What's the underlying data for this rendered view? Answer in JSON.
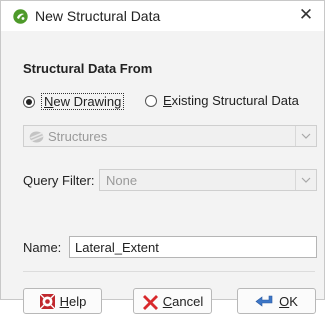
{
  "window": {
    "title": "New Structural Data",
    "close_glyph": "✕",
    "icon": "leapfrog-app-icon"
  },
  "section": {
    "heading": "Structural Data From"
  },
  "source_options": [
    {
      "label_mnemonic": "N",
      "label_rest": "ew Drawing",
      "selected": true
    },
    {
      "label_mnemonic": "E",
      "label_rest": "xisting Structural Data",
      "selected": false
    }
  ],
  "structures_select": {
    "value": "Structures",
    "disabled": true,
    "icon": "structures-icon"
  },
  "query_filter": {
    "label": "Query Filter:",
    "value": "None",
    "disabled": true
  },
  "name_field": {
    "label": "Name:",
    "value": "Lateral_Extent"
  },
  "buttons": {
    "help": {
      "mnemonic": "H",
      "rest": "elp",
      "icon": "help-lifebuoy-icon"
    },
    "cancel": {
      "mnemonic": "C",
      "rest": "ancel",
      "icon": "cancel-x-icon"
    },
    "ok": {
      "mnemonic": "O",
      "rest": "K",
      "icon": "ok-arrow-icon"
    }
  },
  "colors": {
    "accent_green": "#4e9a2a",
    "cancel_red": "#d8282b",
    "help_red": "#c0272d",
    "ok_blue": "#3d76c7"
  }
}
